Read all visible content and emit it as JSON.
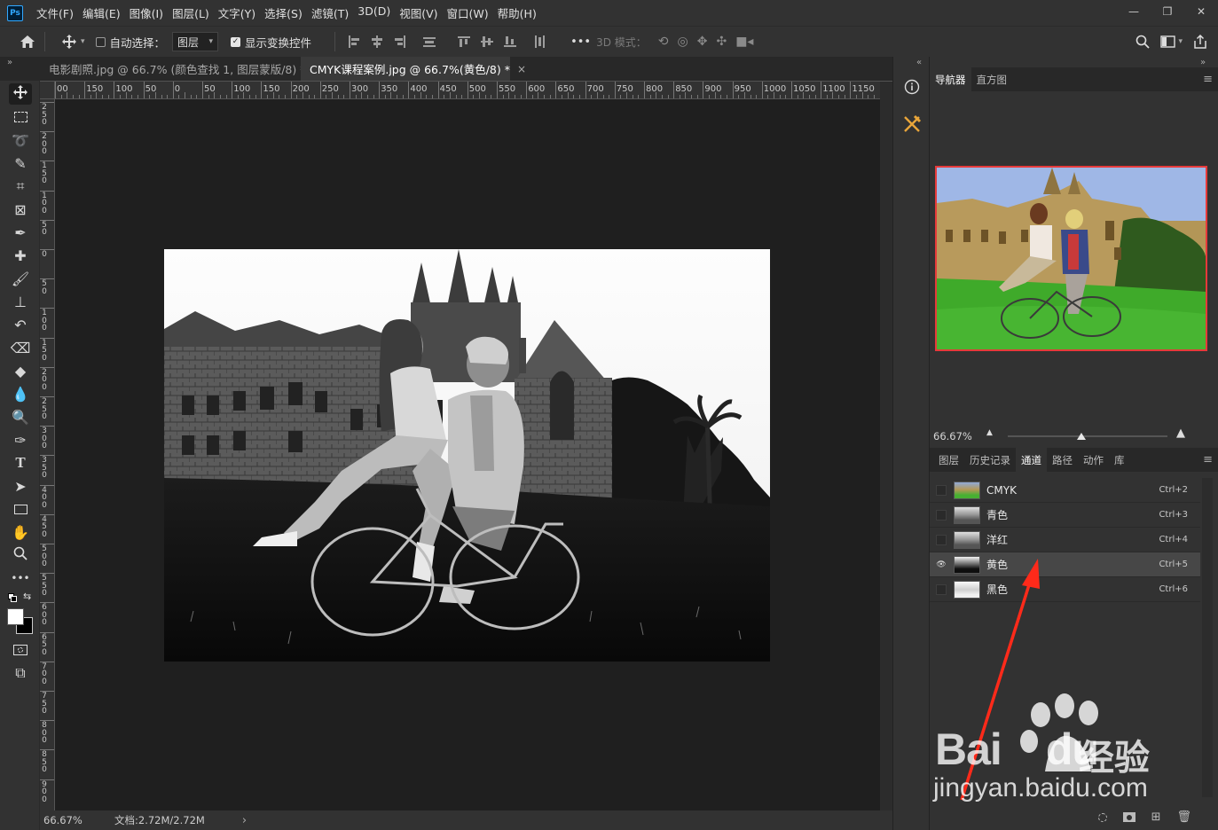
{
  "app": {
    "logo": "Ps"
  },
  "menu": [
    "文件(F)",
    "编辑(E)",
    "图像(I)",
    "图层(L)",
    "文字(Y)",
    "选择(S)",
    "滤镜(T)",
    "3D(D)",
    "视图(V)",
    "窗口(W)",
    "帮助(H)"
  ],
  "window_controls": {
    "minimize": "—",
    "restore": "❐",
    "close": "✕"
  },
  "options_bar": {
    "auto_select_label": "自动选择：",
    "auto_select_checked": false,
    "layer_select_value": "图层",
    "show_transform_label": "显示变换控件",
    "show_transform_checked": true,
    "more_label": "•••",
    "mode_3d_label": "3D 模式："
  },
  "tabs": [
    {
      "title": "电影剧照.jpg @ 66.7% (颜色查找 1, 图层蒙版/8) *",
      "active": false
    },
    {
      "title": "CMYK课程案例.jpg @ 66.7%(黄色/8) *",
      "active": true
    }
  ],
  "tab_close": "×",
  "collapse_left": "»",
  "collapse_mid": "«",
  "collapse_right": "»",
  "ruler_top_labels": [
    "00",
    "150",
    "100",
    "50",
    "0",
    "50",
    "100",
    "150",
    "200",
    "250",
    "300",
    "350",
    "400",
    "450",
    "500",
    "550",
    "600",
    "650",
    "700",
    "750",
    "800",
    "850",
    "900",
    "950",
    "1000",
    "1050",
    "1100",
    "1150"
  ],
  "ruler_left_labels": [
    "250",
    "200",
    "150",
    "100",
    "50",
    "0",
    "50",
    "100",
    "150",
    "200",
    "250",
    "300",
    "350",
    "400",
    "450",
    "500",
    "550",
    "600",
    "650",
    "700",
    "750",
    "800",
    "850",
    "900"
  ],
  "status_bar": {
    "zoom": "66.67%",
    "doc_info": "文档:2.72M/2.72M",
    "arrow": "›"
  },
  "navigator": {
    "tabs": [
      {
        "label": "导航器",
        "active": true
      },
      {
        "label": "直方图",
        "active": false
      }
    ],
    "zoom": "66.67%"
  },
  "panel_menu": "≡",
  "channels_panel": {
    "tabs": [
      {
        "label": "图层",
        "active": false
      },
      {
        "label": "历史记录",
        "active": false
      },
      {
        "label": "通道",
        "active": true
      },
      {
        "label": "路径",
        "active": false
      },
      {
        "label": "动作",
        "active": false
      },
      {
        "label": "库",
        "active": false
      }
    ],
    "channels": [
      {
        "name": "CMYK",
        "shortcut": "Ctrl+2",
        "visible": false,
        "selected": false,
        "thumb": "color"
      },
      {
        "name": "青色",
        "shortcut": "Ctrl+3",
        "visible": false,
        "selected": false,
        "thumb": "gray"
      },
      {
        "name": "洋红",
        "shortcut": "Ctrl+4",
        "visible": false,
        "selected": false,
        "thumb": "gray"
      },
      {
        "name": "黄色",
        "shortcut": "Ctrl+5",
        "visible": true,
        "selected": true,
        "thumb": "dark"
      },
      {
        "name": "黑色",
        "shortcut": "Ctrl+6",
        "visible": false,
        "selected": false,
        "thumb": "light"
      }
    ]
  },
  "annotation": {
    "color": "#ff2a1a"
  },
  "watermark": {
    "brand": "Bai",
    "brand_suffix": "du",
    "cn": "经验",
    "url": "jingyan.baidu.com"
  },
  "colors": {
    "accent": "#31a8ff",
    "nav_frame": "#e63a3a"
  }
}
